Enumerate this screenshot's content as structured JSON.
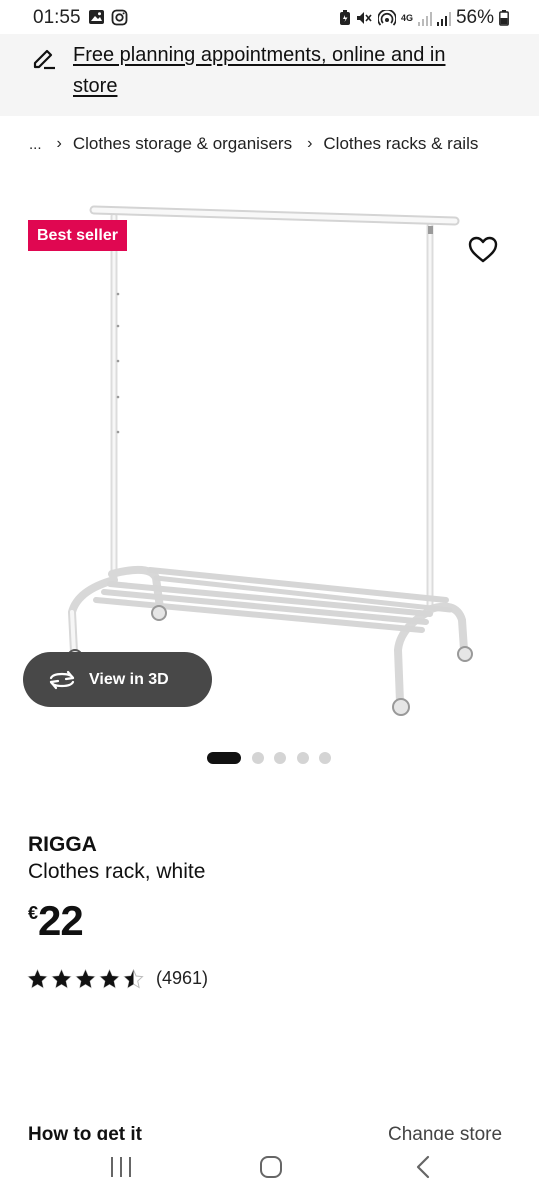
{
  "status_bar": {
    "time": "01:55",
    "network": "4G",
    "battery": "56%"
  },
  "promo": {
    "text": "Free planning appointments, online and in store"
  },
  "breadcrumb": {
    "ellipsis": "...",
    "items": [
      "Clothes storage & organisers",
      "Clothes racks & rails"
    ]
  },
  "product": {
    "badge": "Best seller",
    "view_3d_label": "View in 3D",
    "name": "RIGGA",
    "description": "Clothes rack, white",
    "currency": "€",
    "price": "22",
    "rating": 4.5,
    "review_count": "(4961)",
    "image_count": 5,
    "active_image": 0
  },
  "cutoff": {
    "left_text": "How to get it",
    "right_text": "Change store"
  },
  "colors": {
    "badge_bg": "#e00751",
    "button_bg": "#484848",
    "banner_bg": "#f5f5f5"
  }
}
